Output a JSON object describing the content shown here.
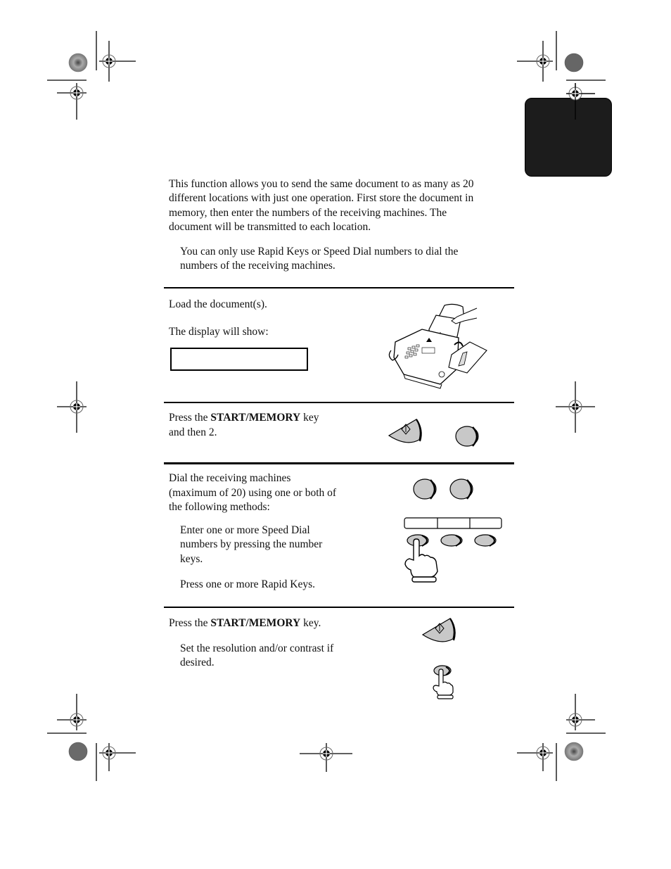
{
  "intro": {
    "lines": [
      "This function allows you to send the same document to as many as 20",
      "different locations with just one operation. First store the document in",
      "memory, then enter the numbers of the receiving machines. The",
      "document will be transmitted to each location."
    ],
    "note_lines": [
      "You can only use Rapid Keys or Speed Dial numbers to dial the",
      "numbers of the receiving machines."
    ]
  },
  "steps": [
    {
      "lines": [
        "Load the document(s)."
      ],
      "display_label": "The display will show:",
      "display_value": "",
      "illustration": "fax-machine-loading-document"
    },
    {
      "prefix": "Press the ",
      "key_name": "START/MEMORY",
      "suffix": " key",
      "line2": "and then 2.",
      "illustration": [
        "start-memory-key",
        "number-key-2"
      ]
    },
    {
      "lines": [
        "Dial the receiving machines",
        "(maximum of 20) using one or both of",
        "the following methods:"
      ],
      "methods": [
        [
          "Enter one or more Speed Dial",
          "numbers by pressing the number",
          "keys."
        ],
        [
          "Press one or more Rapid Keys."
        ]
      ],
      "illustration": [
        "number-keys",
        "rapid-keys",
        "pressing-hand"
      ]
    },
    {
      "prefix": "Press the ",
      "key_name": "START/MEMORY",
      "suffix": " key.",
      "note_lines": [
        "Set the resolution and/or contrast if",
        "desired."
      ],
      "illustration": [
        "start-memory-key",
        "pressing-hand"
      ]
    }
  ],
  "colors": {
    "key_fill": "#c8c8c8",
    "tab_fill": "#1c1c1c",
    "text": "#111111"
  }
}
